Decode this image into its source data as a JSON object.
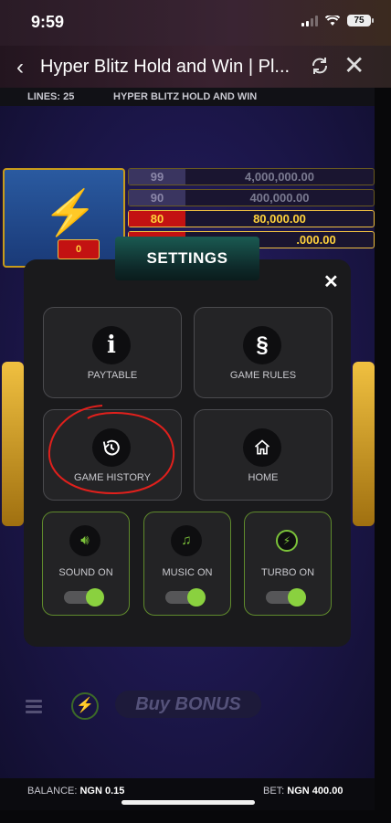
{
  "status_bar": {
    "time": "9:59",
    "battery": "75"
  },
  "browser": {
    "title": "Hyper Blitz Hold and Win | Pl..."
  },
  "game_info": {
    "lines_label": "LINES: 25",
    "game_name": "HYPER BLITZ HOLD AND WIN"
  },
  "game": {
    "bolt_counter": "0",
    "paytable": [
      {
        "multiplier": "99",
        "value": "4,000,000.00",
        "active": false
      },
      {
        "multiplier": "90",
        "value": "400,000.00",
        "active": false
      },
      {
        "multiplier": "80",
        "value": "80,000.00",
        "active": true
      },
      {
        "multiplier": "",
        "value": ".000.00",
        "active": true
      }
    ],
    "buy_bonus": "Buy BONUS"
  },
  "settings": {
    "title": "SETTINGS",
    "buttons": [
      {
        "label": "PAYTABLE",
        "icon": "info-icon"
      },
      {
        "label": "GAME RULES",
        "icon": "section-icon"
      },
      {
        "label": "GAME HISTORY",
        "icon": "history-icon"
      },
      {
        "label": "HOME",
        "icon": "home-icon"
      }
    ],
    "toggles": [
      {
        "label": "SOUND ON",
        "icon": "speaker-icon",
        "on": true
      },
      {
        "label": "MUSIC ON",
        "icon": "music-icon",
        "on": true
      },
      {
        "label": "TURBO ON",
        "icon": "bolt-icon",
        "on": true
      }
    ]
  },
  "footer": {
    "balance_label": "BALANCE:",
    "balance_value": "NGN 0.15",
    "bet_label": "BET:",
    "bet_value": "NGN 400.00"
  },
  "colors": {
    "accent_green": "#8ad13f",
    "annotation_red": "#e0201c",
    "gold": "#ffd23b"
  }
}
